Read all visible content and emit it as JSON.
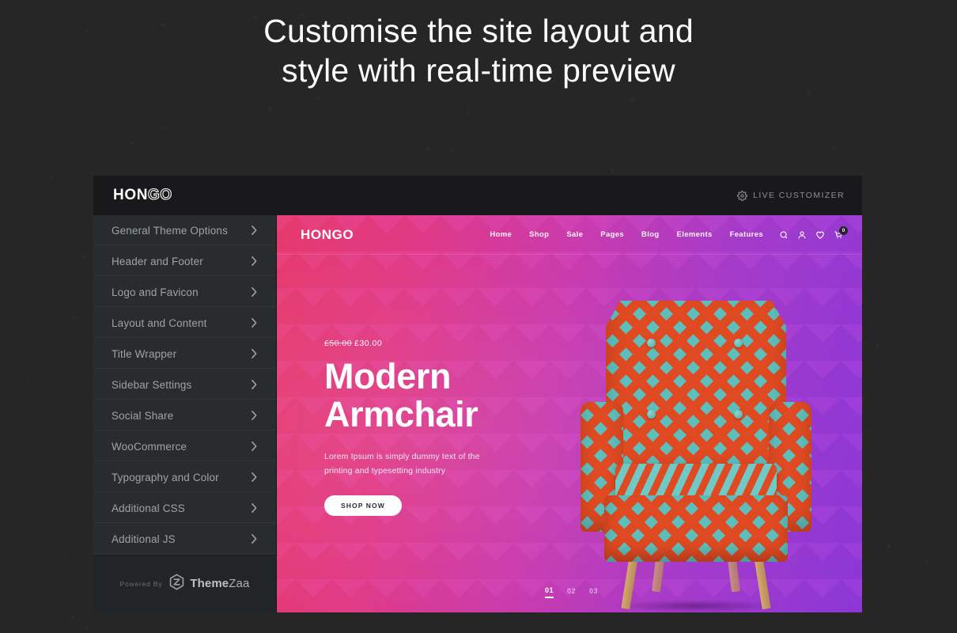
{
  "headline": {
    "line1": "Customise the site layout and",
    "line2": "style with real-time preview"
  },
  "panel": {
    "logo_bold": "HON",
    "logo_light": "GO",
    "live_customizer_label": "LIVE CUSTOMIZER",
    "gear_icon": "gear-icon"
  },
  "sidebar": {
    "items": [
      {
        "label": "General Theme Options",
        "chevron": "chevron-right-icon"
      },
      {
        "label": "Header and Footer",
        "chevron": "chevron-right-icon"
      },
      {
        "label": "Logo and Favicon",
        "chevron": "chevron-right-icon"
      },
      {
        "label": "Layout and Content",
        "chevron": "chevron-right-icon"
      },
      {
        "label": "Title Wrapper",
        "chevron": "chevron-right-icon"
      },
      {
        "label": "Sidebar Settings",
        "chevron": "chevron-right-icon"
      },
      {
        "label": "Social Share",
        "chevron": "chevron-right-icon"
      },
      {
        "label": "WooCommerce",
        "chevron": "chevron-right-icon"
      },
      {
        "label": "Typography and Color",
        "chevron": "chevron-right-icon"
      },
      {
        "label": "Additional CSS",
        "chevron": "chevron-right-icon"
      },
      {
        "label": "Additional JS",
        "chevron": "chevron-right-icon"
      }
    ],
    "footer": {
      "powered_by": "Powered By",
      "brand_bold": "Theme",
      "brand_light": "Zaa",
      "brand_icon": "themezaa-hexagon-icon"
    }
  },
  "preview": {
    "logo_bold": "HON",
    "logo_light": "GO",
    "nav_links": [
      "Home",
      "Shop",
      "Sale",
      "Pages",
      "Blog",
      "Elements",
      "Features"
    ],
    "icons": [
      {
        "name": "search-icon"
      },
      {
        "name": "user-icon"
      },
      {
        "name": "heart-icon"
      },
      {
        "name": "cart-icon",
        "badge": "0"
      }
    ],
    "hero": {
      "price_old": "£50.00",
      "price_new": "£30.00",
      "title_line1": "Modern",
      "title_line2": "Armchair",
      "description_line1": "Lorem Ipsum is simply dummy text of the",
      "description_line2": "printing and typesetting industry",
      "cta_label": "SHOP NOW",
      "pagination": [
        "01",
        "02",
        "03"
      ],
      "active_slide": "01",
      "product_image": "chevron-pattern-armchair"
    }
  },
  "colors": {
    "page_background": "#262626",
    "panel_header": "#19191b",
    "sidebar": "#282c2e",
    "sidebar_footer": "#212527",
    "hero_pink": "#e63a6d",
    "hero_purple": "#8b37d6",
    "menu_label": "#9ea3a7",
    "chair_orange": "#e04a22",
    "chair_teal": "#5dbfbc",
    "chair_wood": "#c99a64"
  }
}
